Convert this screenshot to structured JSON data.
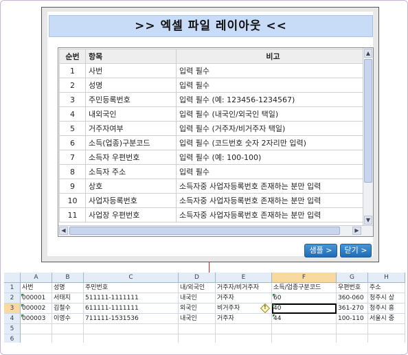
{
  "popup": {
    "title": ">> 엑셀 파일 레이아웃 <<",
    "columns": [
      "순번",
      "항목",
      "비고"
    ],
    "rows": [
      [
        "1",
        "사번",
        "입력 필수"
      ],
      [
        "2",
        "성명",
        "입력 필수"
      ],
      [
        "3",
        "주민등록번호",
        "입력 필수 (예: 123456-1234567)"
      ],
      [
        "4",
        "내외국인",
        "입력 필수 (내국인/외국인 택일)"
      ],
      [
        "5",
        "거주자여부",
        "입력 필수 (거주자/비거주자 택일)"
      ],
      [
        "6",
        "소득(업종)구분코드",
        "입력 필수 (코드번호 숫자 2자리만 입력)"
      ],
      [
        "7",
        "소득자 우편번호",
        "입력 필수 (예: 100-100)"
      ],
      [
        "8",
        "소득자 주소",
        "입력 필수"
      ],
      [
        "9",
        "상호",
        "소득자중 사업자등록번호 존재하는 분만 입력"
      ],
      [
        "10",
        "사업자등록번호",
        "소득자중 사업자등록번호 존재하는 분만 입력"
      ],
      [
        "11",
        "사업장 우편번호",
        "소득자중 사업자등록번호 존재하는 분만 입력"
      ]
    ],
    "sample_button": "샘플 >",
    "close_button": "닫기 >",
    "scroll_up": "▲",
    "scroll_down": "▼",
    "scroll_left": "◀",
    "scroll_right": "▶"
  },
  "excel": {
    "column_letters": [
      "",
      "A",
      "B",
      "C",
      "D",
      "E",
      "F",
      "G",
      "H"
    ],
    "selected_column": "F",
    "selected_row": "3",
    "rows": [
      [
        "1",
        "사번",
        "성명",
        "주민번호",
        "내/외국인",
        "거주자/비거주자",
        "소득/업종구분코드",
        "우편번호",
        "주소"
      ],
      [
        "2",
        "000001",
        "서태지",
        "511111-1111111",
        "내국인",
        "거주자",
        "60",
        "360-060",
        "청주시 상"
      ],
      [
        "3",
        "000002",
        "김철수",
        "611111-1111111",
        "외국인",
        "비거주자",
        "40",
        "361-270",
        "청주시 흥"
      ],
      [
        "4",
        "000003",
        "이영수",
        "711111-1531536",
        "내국인",
        "거주자",
        "44",
        "100-110",
        "서울시 중"
      ],
      [
        "5",
        "",
        "",
        "",
        "",
        "",
        "",
        "",
        ""
      ],
      [
        "6",
        "",
        "",
        "",
        "",
        "",
        "",
        "",
        ""
      ]
    ],
    "warning_mark": "!"
  }
}
